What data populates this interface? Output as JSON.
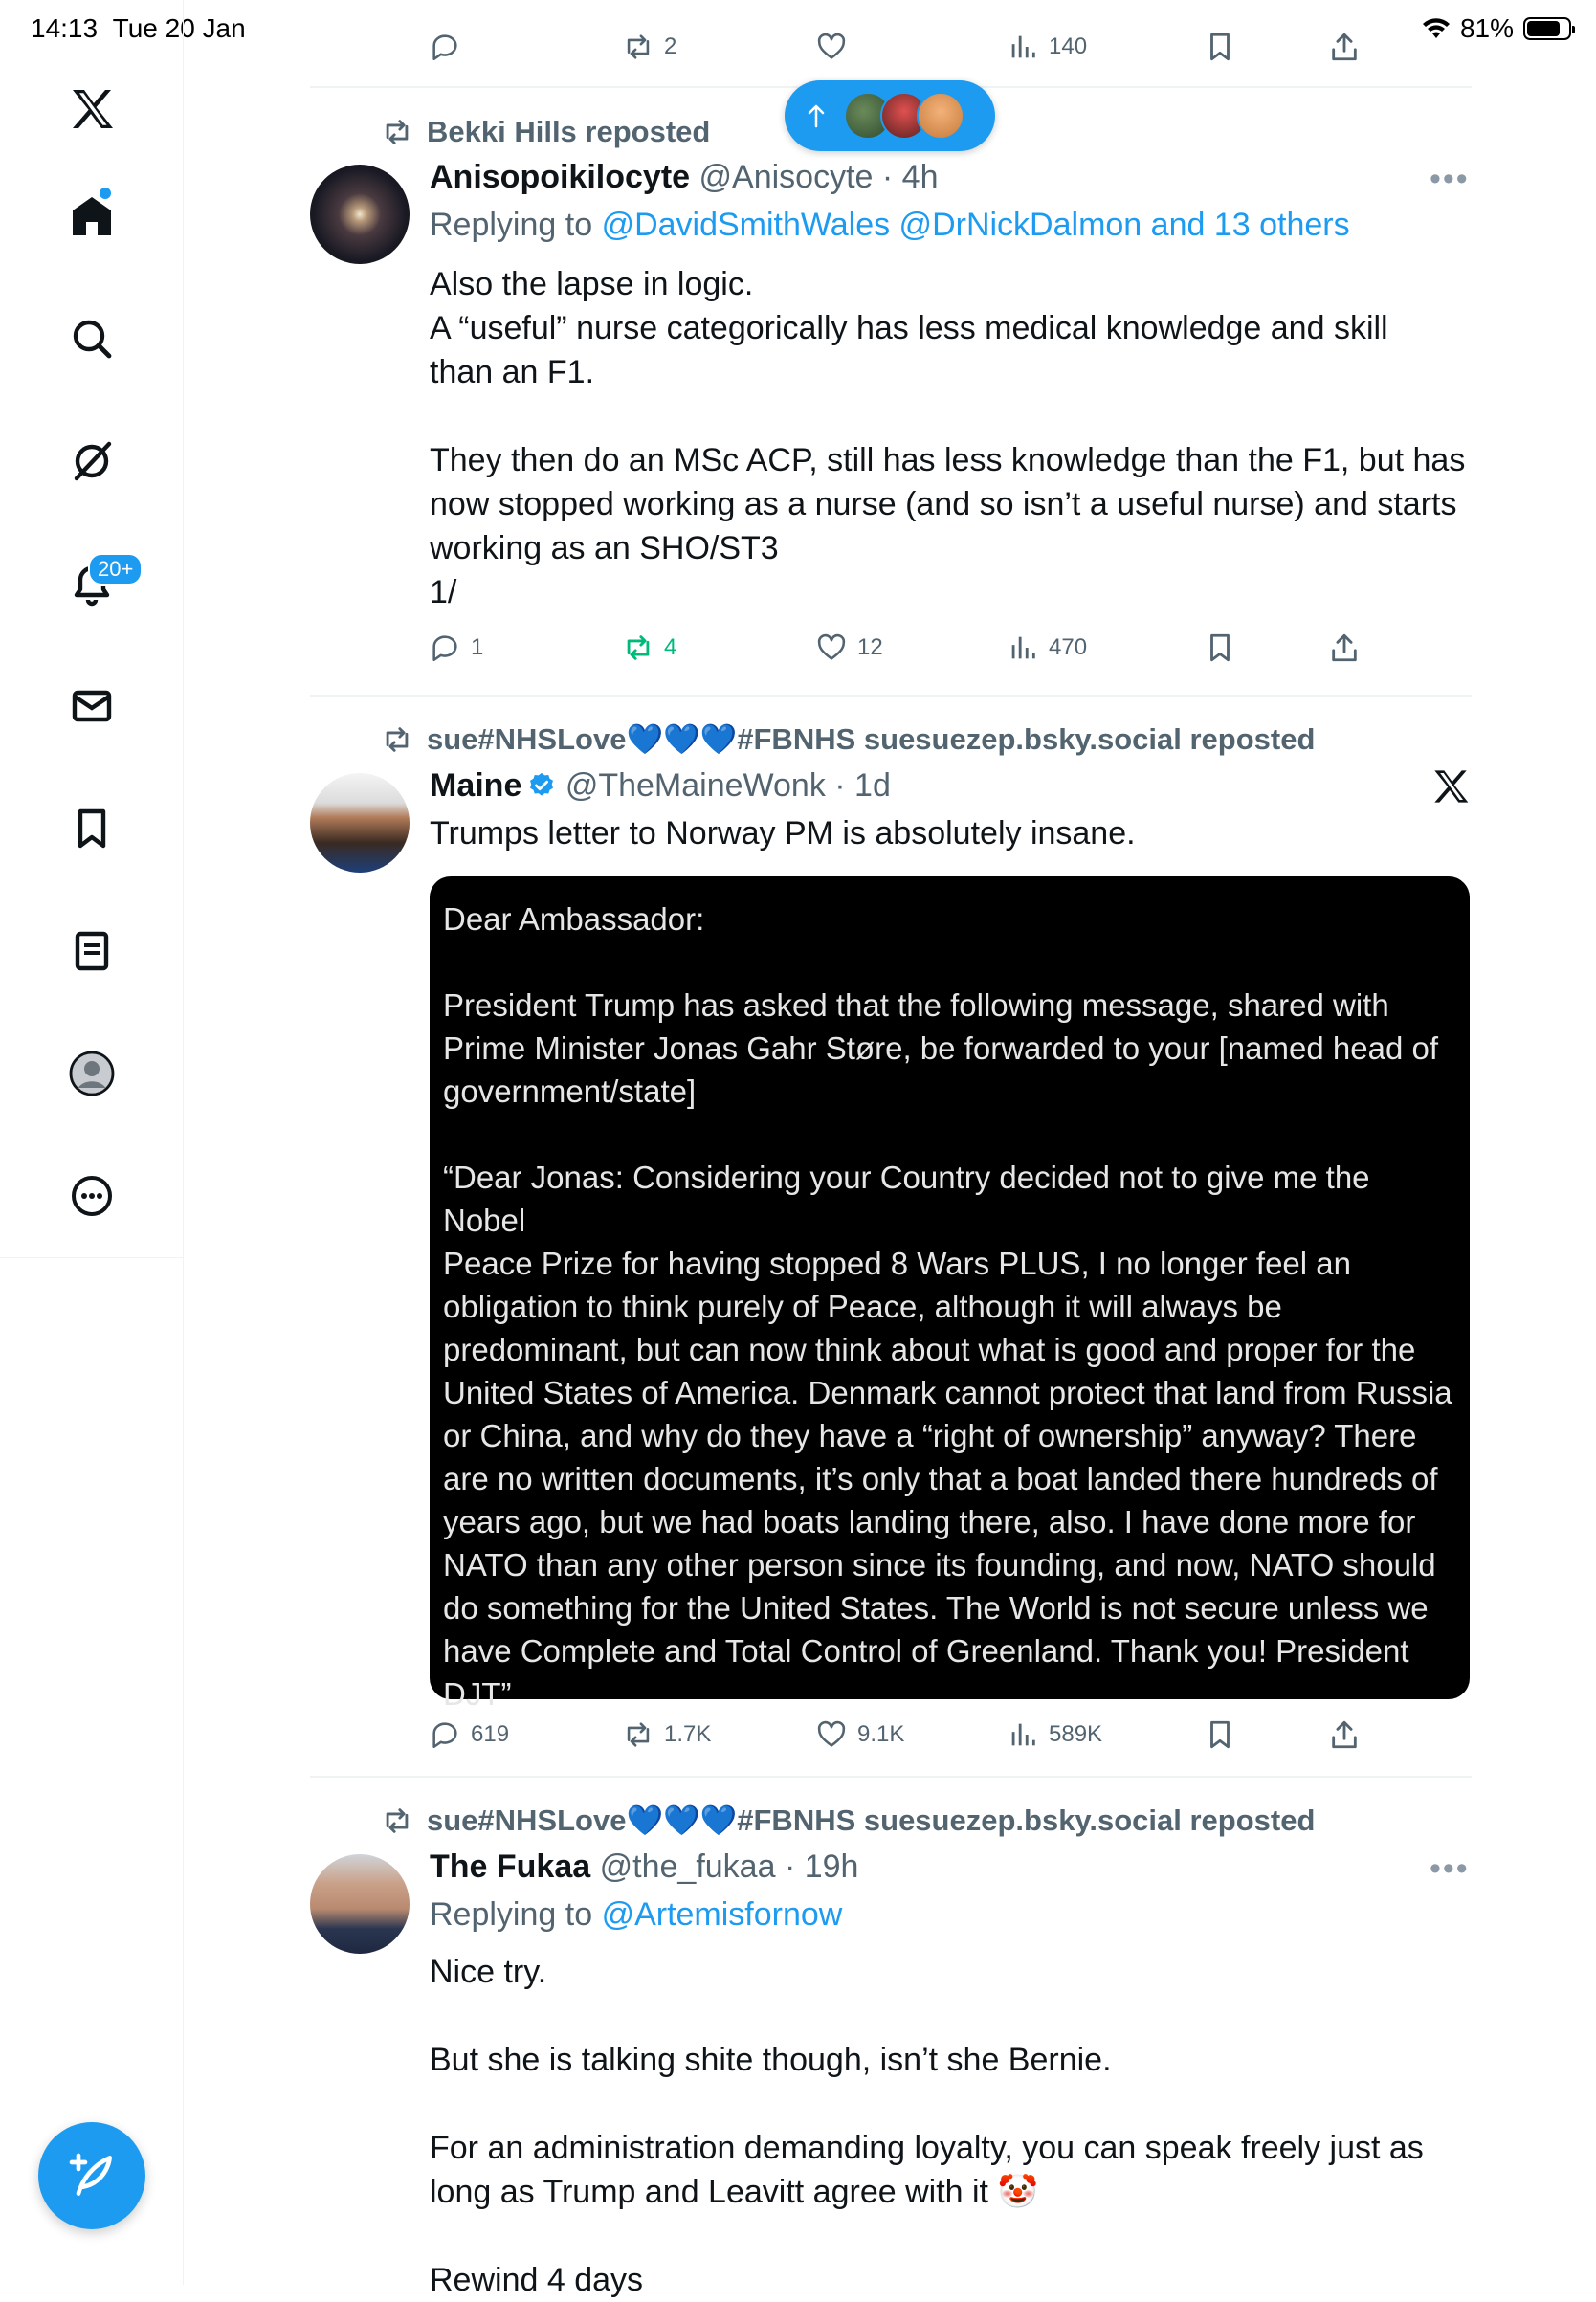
{
  "status_bar": {
    "time": "14:13",
    "date": "Tue 20 Jan",
    "battery": "81%",
    "battery_level": 0.81
  },
  "sidebar": {
    "items": [
      {
        "name": "home"
      },
      {
        "name": "explore"
      },
      {
        "name": "grok"
      },
      {
        "name": "notifications"
      },
      {
        "name": "messages"
      },
      {
        "name": "bookmarks"
      },
      {
        "name": "lists"
      },
      {
        "name": "profile"
      },
      {
        "name": "more"
      }
    ],
    "notifications_badge": "20+"
  },
  "top_partial": {
    "actions": {
      "replies": "",
      "reposts": "2",
      "likes": "",
      "views": "140"
    }
  },
  "posts": [
    {
      "repost_by": "Bekki Hills reposted",
      "name": "Anisopoikilocyte",
      "handle": "@Anisocyte",
      "time": "4h",
      "replying_prefix": "Replying to",
      "replying_to": "@DavidSmithWales @DrNickDalmon and 13 others",
      "lines": [
        "Also the lapse in logic.",
        "A “useful” nurse categorically has less medical knowledge and skill",
        "than an F1.",
        "",
        "They then do an MSc ACP, still has less knowledge than the F1, but has",
        "now stopped working as a nurse (and so isn’t a useful nurse) and starts",
        "working as an SHO/ST3",
        "1/"
      ],
      "actions": {
        "replies": "1",
        "reposts": "4",
        "likes": "12",
        "views": "470"
      }
    },
    {
      "repost_by": "sue#NHSLove💙💙💙#FBNHS suesuezep.bsky.social reposted",
      "name": "Maine",
      "handle": "@TheMaineWonk",
      "time": "1d",
      "text": "Trumps letter to Norway PM is absolutely insane.",
      "image_text": [
        "Dear Ambassador:",
        "",
        "President Trump has asked that the following message, shared with",
        "Prime Minister Jonas Gahr Støre, be forwarded to your [named head of",
        "government/state]",
        "",
        "“Dear Jonas: Considering your Country decided not to give me the Nobel",
        "Peace Prize for having stopped 8 Wars PLUS, I no longer feel an",
        "obligation to think purely of Peace, although it will always be",
        "predominant, but can now think about what is good and proper for the",
        "United States of America. Denmark cannot protect that land from Russia",
        "or China, and why do they have a “right of ownership” anyway? There",
        "are no written documents, it’s only that a boat landed there hundreds of",
        "years ago, but we had boats landing there, also. I have done more for",
        "NATO than any other person since its founding, and now, NATO should",
        "do something for the United States. The World is not secure unless we",
        "have Complete and Total Control of Greenland. Thank you! President",
        "DJT”"
      ],
      "actions": {
        "replies": "619",
        "reposts": "1.7K",
        "likes": "9.1K",
        "views": "589K"
      }
    },
    {
      "repost_by": "sue#NHSLove💙💙💙#FBNHS suesuezep.bsky.social reposted",
      "name": "The Fukaa",
      "handle": "@the_fukaa",
      "time": "19h",
      "replying_prefix": "Replying to",
      "replying_to": "@Artemisfornow",
      "lines": [
        "Nice try.",
        "",
        "But she is talking shite though, isn’t she Bernie.",
        "",
        "For an administration demanding loyalty, you can speak freely just as",
        "long as Trump and Leavitt agree with it 🤡",
        "",
        "Rewind 4 days"
      ]
    }
  ],
  "colors": {
    "accent": "#1d9bf0",
    "repost_green": "#00ba7c",
    "muted": "#536471"
  },
  "more_label": "•••"
}
